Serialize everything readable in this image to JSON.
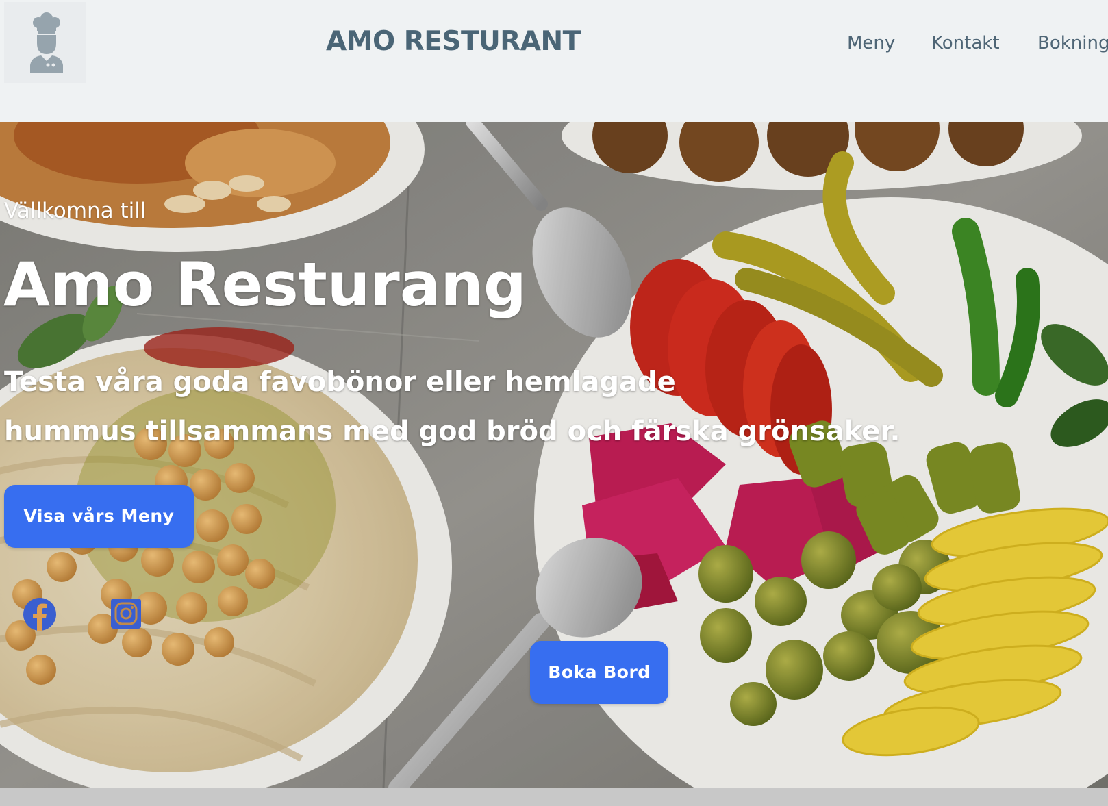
{
  "header": {
    "logo_icon": "chef-avatar-icon",
    "title": "AMO RESTURANT",
    "nav": {
      "menu": "Meny",
      "contact": "Kontakt",
      "booking": "Bokning"
    }
  },
  "hero": {
    "welcome": "Vällkomna till",
    "title": "Amo Resturang",
    "tagline_line1": "Testa våra goda favobönor eller hemlagade",
    "tagline_line2": "hummus tillsammans med god bröd och färska grönsaker.",
    "menu_button": "Visa vårs Meny",
    "book_button": "Boka Bord",
    "social": {
      "facebook_icon": "facebook-icon",
      "instagram_icon": "instagram-icon"
    }
  },
  "colors": {
    "header_bg": "#eff2f3",
    "title_color": "#4a6576",
    "nav_color": "#4f6676",
    "button_bg": "#376ef0",
    "text_white": "#ffffff"
  }
}
